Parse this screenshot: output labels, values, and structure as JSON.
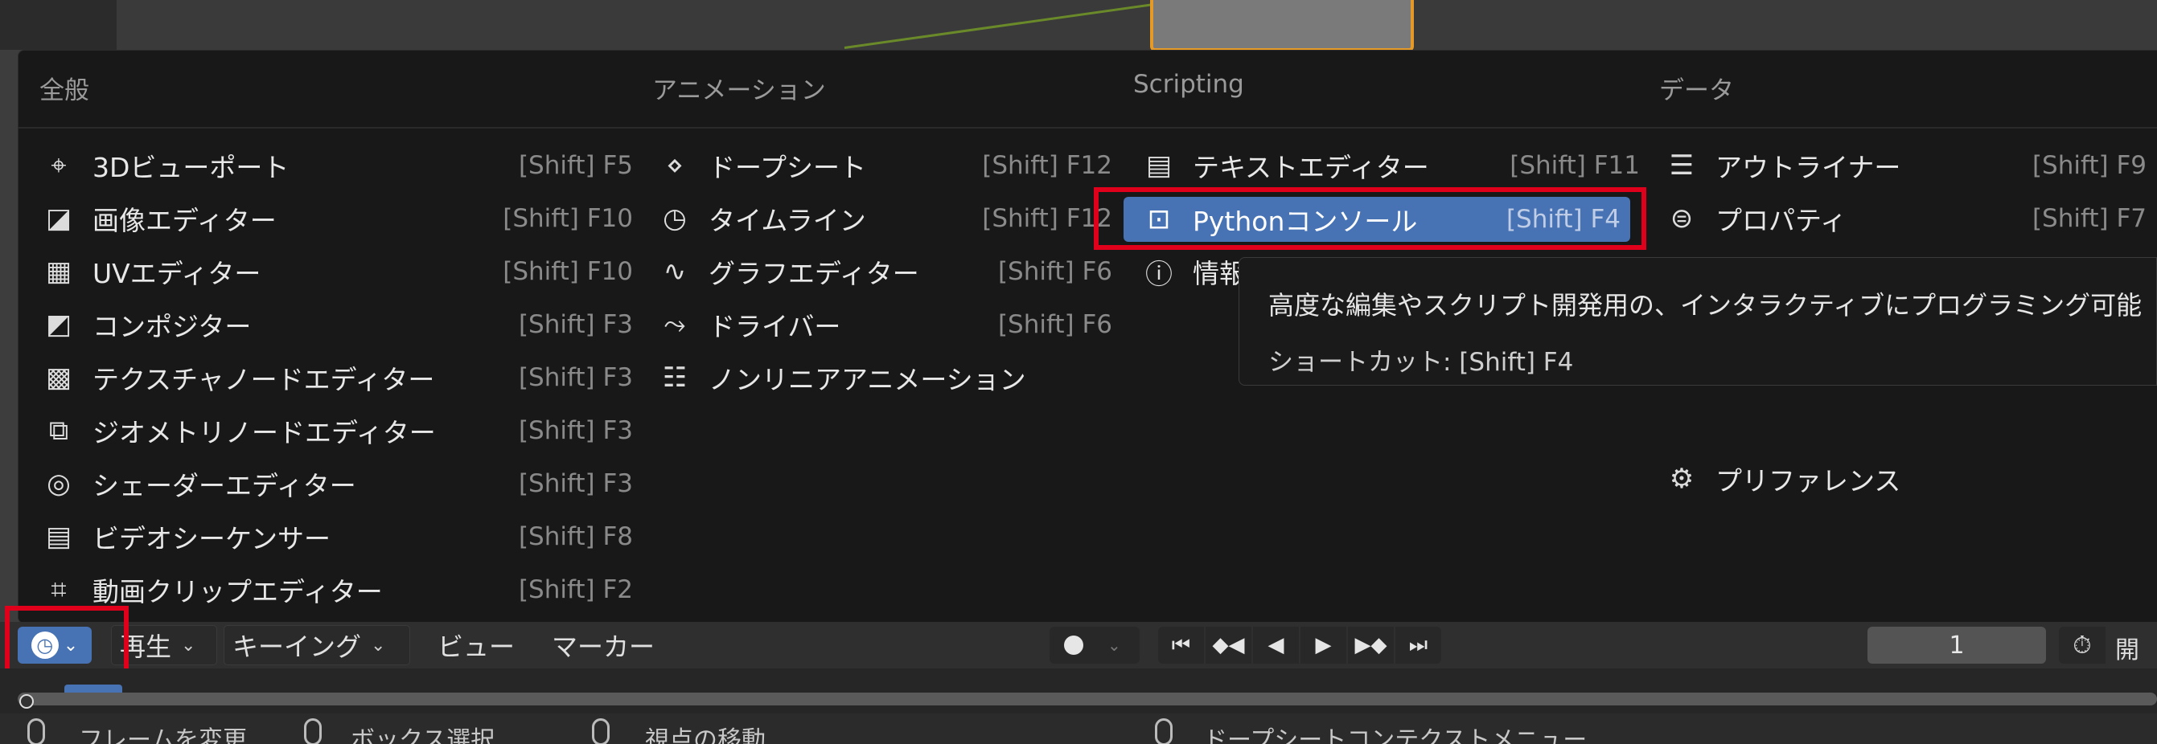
{
  "columns": {
    "general": {
      "title": "全般",
      "items": [
        {
          "label": "3Dビューポート",
          "shortcut": "[Shift] F5",
          "icon": "viewport-3d-icon"
        },
        {
          "label": "画像エディター",
          "shortcut": "[Shift] F10",
          "icon": "image-editor-icon"
        },
        {
          "label": "UVエディター",
          "shortcut": "[Shift] F10",
          "icon": "uv-editor-icon"
        },
        {
          "label": "コンポジター",
          "shortcut": "[Shift] F3",
          "icon": "compositor-icon"
        },
        {
          "label": "テクスチャノードエディター",
          "shortcut": "[Shift] F3",
          "icon": "texture-node-icon"
        },
        {
          "label": "ジオメトリノードエディター",
          "shortcut": "[Shift] F3",
          "icon": "geometry-node-icon"
        },
        {
          "label": "シェーダーエディター",
          "shortcut": "[Shift] F3",
          "icon": "shader-editor-icon"
        },
        {
          "label": "ビデオシーケンサー",
          "shortcut": "[Shift] F8",
          "icon": "video-sequencer-icon"
        },
        {
          "label": "動画クリップエディター",
          "shortcut": "[Shift] F2",
          "icon": "movie-clip-icon"
        }
      ]
    },
    "animation": {
      "title": "アニメーション",
      "items": [
        {
          "label": "ドープシート",
          "shortcut": "[Shift] F12",
          "icon": "dope-sheet-icon"
        },
        {
          "label": "タイムライン",
          "shortcut": "[Shift] F12",
          "icon": "timeline-icon"
        },
        {
          "label": "グラフエディター",
          "shortcut": "[Shift] F6",
          "icon": "graph-editor-icon"
        },
        {
          "label": "ドライバー",
          "shortcut": "[Shift] F6",
          "icon": "drivers-icon"
        },
        {
          "label": "ノンリニアアニメーション",
          "shortcut": "",
          "icon": "nla-icon"
        }
      ]
    },
    "scripting": {
      "title": "Scripting",
      "items": [
        {
          "label": "テキストエディター",
          "shortcut": "[Shift] F11",
          "icon": "text-editor-icon"
        },
        {
          "label": "Pythonコンソール",
          "shortcut": "[Shift] F4",
          "icon": "console-icon"
        },
        {
          "label": "情報",
          "shortcut": "",
          "icon": "info-icon"
        }
      ]
    },
    "data": {
      "title": "データ",
      "items": [
        {
          "label": "アウトライナー",
          "shortcut": "[Shift] F9",
          "icon": "outliner-icon"
        },
        {
          "label": "プロパティ",
          "shortcut": "[Shift] F7",
          "icon": "properties-icon"
        },
        {
          "label": "プリファレンス",
          "shortcut": "",
          "icon": "preferences-icon"
        }
      ]
    }
  },
  "tooltip": {
    "description": "高度な編集やスクリプト開発用の、インタラクティブにプログラミング可能",
    "shortcut_line": "ショートカット: [Shift] F4"
  },
  "timeline_header": {
    "menus": [
      "再生",
      "キーイング",
      "ビュー",
      "マーカー"
    ],
    "current_frame": "1",
    "start_label": "開"
  },
  "status_bar": {
    "items": [
      "フレームを変更",
      "ボックス選択",
      "視点の移動",
      "ドープシートコンテクストメニュー"
    ]
  },
  "colors": {
    "accent": "#4772b3",
    "highlight_box": "#e0001b",
    "menu_bg": "#181818"
  }
}
